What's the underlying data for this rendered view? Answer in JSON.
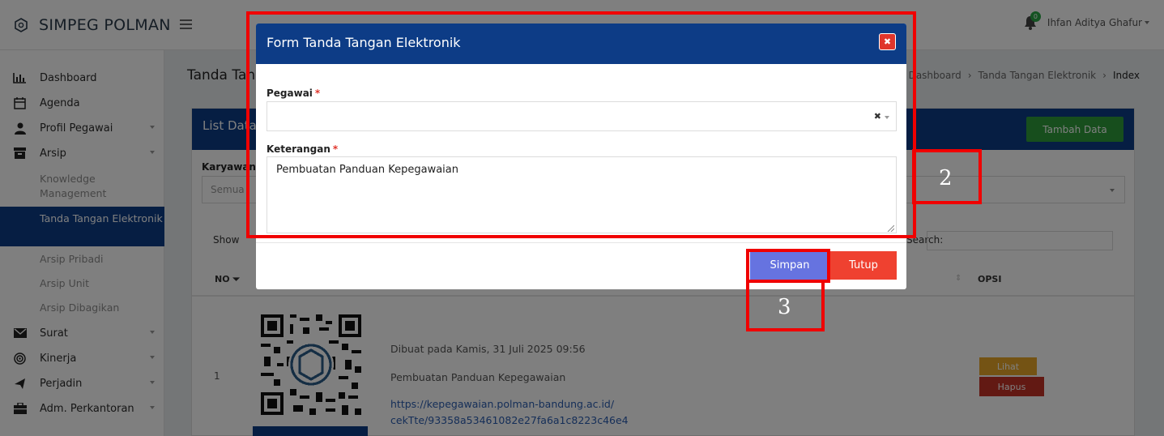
{
  "topbar": {
    "brand": "SIMPEG POLMAN",
    "notification_count": "0",
    "user_name": "Ihfan Aditya Ghafur"
  },
  "sidebar": {
    "items": [
      {
        "label": "Dashboard",
        "icon": "bar-chart-icon"
      },
      {
        "label": "Agenda",
        "icon": "calendar-icon"
      },
      {
        "label": "Profil Pegawai",
        "icon": "user-icon"
      },
      {
        "label": "Arsip",
        "icon": "archive-icon"
      },
      {
        "label": "Surat",
        "icon": "envelope-icon"
      },
      {
        "label": "Kinerja",
        "icon": "target-icon"
      },
      {
        "label": "Perjadin",
        "icon": "plane-icon"
      },
      {
        "label": "Adm. Perkantoran",
        "icon": "briefcase-icon"
      }
    ],
    "arsip_sub": [
      "Knowledge Management",
      "Tanda Tangan Elektronik",
      "Arsip Pribadi",
      "Arsip Unit",
      "Arsip Dibagikan"
    ]
  },
  "page": {
    "title": "Tanda Tangan Elektronik",
    "breadcrumb": [
      "Dashboard",
      "Tanda Tangan Elektronik",
      "Index"
    ],
    "card_title": "List Data",
    "add_button": "Tambah Data",
    "filter_label": "Karyawan",
    "filter_value": "Semua",
    "show_label": "Show",
    "search_label": "Search:",
    "columns": {
      "no": "NO",
      "opsi": "OPSI"
    },
    "rows": [
      {
        "no": "1",
        "created": "Dibuat pada Kamis, 31 Juli 2025 09:56",
        "description": "Pembuatan Panduan Kepegawaian",
        "link_line1": "https://kepegawaian.polman-bandung.ac.id/",
        "link_line2": "cekTte/93358a53461082e27fa6a1c8223c46e4",
        "view_button": "Lihat",
        "delete_button": "Hapus"
      }
    ]
  },
  "modal": {
    "title": "Form Tanda Tangan Elektronik",
    "pegawai_label": "Pegawai",
    "keterangan_label": "Keterangan",
    "required_mark": "*",
    "keterangan_value": "Pembuatan Panduan Kepegawaian",
    "save_button": "Simpan",
    "close_button": "Tutup"
  },
  "annotations": [
    "2",
    "3"
  ],
  "colors": {
    "primary": "#0d3c86",
    "success": "#2e9d3a",
    "danger": "#ef4130",
    "save": "#6673e0",
    "annotation": "#f00000"
  }
}
